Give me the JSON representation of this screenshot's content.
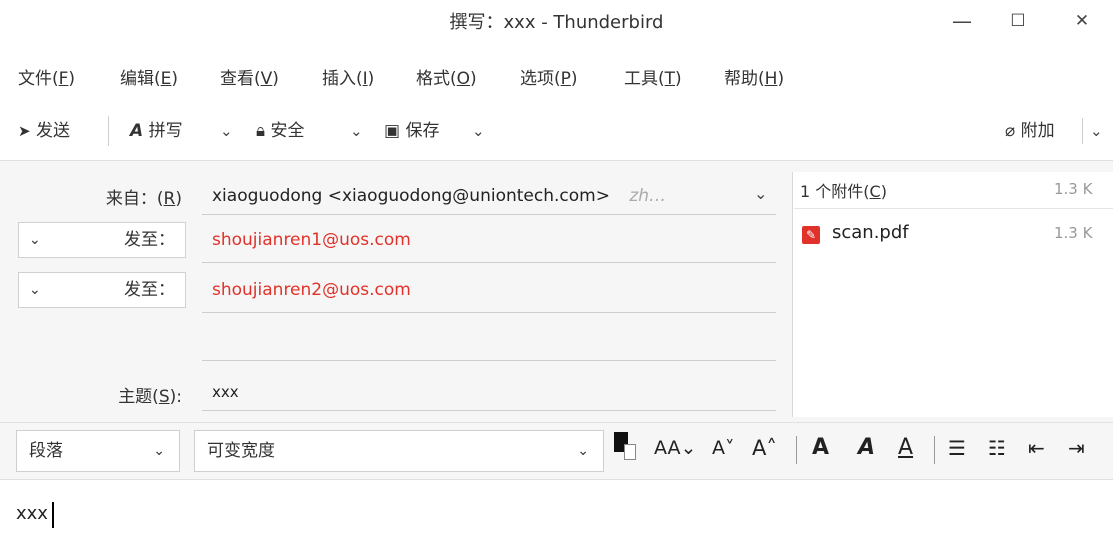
{
  "window": {
    "title": "撰写：xxx - Thunderbird",
    "minimize": "—",
    "maximize": "☐",
    "close": "✕"
  },
  "menu": [
    {
      "label": "文件",
      "key": "F"
    },
    {
      "label": "编辑",
      "key": "E"
    },
    {
      "label": "查看",
      "key": "V"
    },
    {
      "label": "插入",
      "key": "I"
    },
    {
      "label": "格式",
      "key": "O"
    },
    {
      "label": "选项",
      "key": "P"
    },
    {
      "label": "工具",
      "key": "T"
    },
    {
      "label": "帮助",
      "key": "H"
    }
  ],
  "toolbar": {
    "send": "发送",
    "spell": "拼写",
    "security": "安全",
    "save": "保存",
    "attach": "附加"
  },
  "header": {
    "from_label": "来自：",
    "from_key": "R",
    "from_value": "xiaoguodong <xiaoguodong@uniontech.com>",
    "from_extra": "zh…",
    "to_label": "发至：",
    "recipients": [
      "shoujianren1@uos.com",
      "shoujianren2@uos.com"
    ],
    "subject_label": "主题(",
    "subject_key": "S",
    "subject_label_end": "):",
    "subject_value": "xxx"
  },
  "attachments": {
    "count_label": "1 个附件(",
    "count_key": "C",
    "count_label_end": ")",
    "total_size": "1.3 K",
    "items": [
      {
        "name": "scan.pdf",
        "size": "1.3 K"
      }
    ]
  },
  "format": {
    "paragraph": "段落",
    "font": "可变宽度"
  },
  "body": {
    "text": "xxx"
  },
  "colors": {
    "recipient": "#e0322a",
    "pdf_icon": "#e0322a"
  }
}
